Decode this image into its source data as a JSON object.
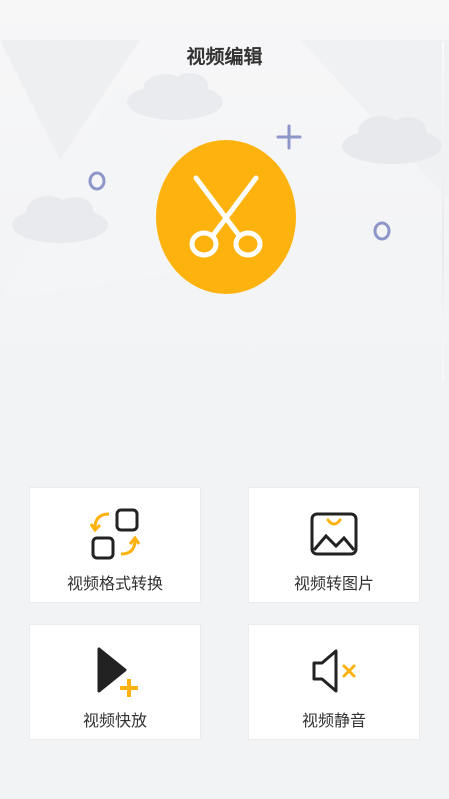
{
  "header": {
    "title": "视频编辑"
  },
  "hero": {
    "icon": "scissors-icon",
    "accent": "#fdb20e"
  },
  "features": [
    {
      "label": "视频格式转换",
      "icon": "format-convert-icon"
    },
    {
      "label": "视频转图片",
      "icon": "image-icon"
    },
    {
      "label": "视频快放",
      "icon": "play-fast-icon"
    },
    {
      "label": "视频静音",
      "icon": "mute-icon"
    }
  ],
  "colors": {
    "accent": "#fdb20e",
    "decor": "#8e96c8",
    "text": "#333333"
  }
}
